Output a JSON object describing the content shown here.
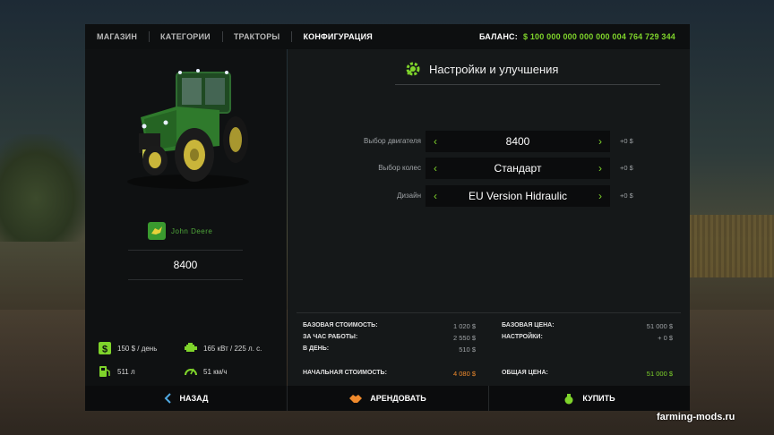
{
  "breadcrumbs": [
    "МАГАЗИН",
    "КАТЕГОРИИ",
    "ТРАКТОРЫ",
    "КОНФИГУРАЦИЯ"
  ],
  "balance": {
    "label": "БАЛАНС:",
    "amount": "$ 100 000 000 000 000 004 764 729 344"
  },
  "vehicle": {
    "brand": "John Deere",
    "model": "8400"
  },
  "stats": {
    "cost_per_day": "150 $ / день",
    "power": "165 кВт / 225 л. с.",
    "fuel": "511 л",
    "speed": "51 км/ч"
  },
  "config": {
    "title": "Настройки и улучшения",
    "options": [
      {
        "label": "Выбор двигателя",
        "value": "8400",
        "price": "+0 $"
      },
      {
        "label": "Выбор колес",
        "value": "Стандарт",
        "price": "+0 $"
      },
      {
        "label": "Дизайн",
        "value": "EU Version Hidraulic",
        "price": "+0 $"
      }
    ]
  },
  "costs": {
    "base_cost_label": "БАЗОВАЯ СТОИМОСТЬ:",
    "base_cost": "1 020 $",
    "per_hour_label": "ЗА ЧАС РАБОТЫ:",
    "per_hour": "2 550 $",
    "per_day_label": "В ДЕНЬ:",
    "per_day": "510 $",
    "initial_label": "НАЧАЛЬНАЯ СТОИМОСТЬ:",
    "initial": "4 080 $",
    "base_price_label": "БАЗОВАЯ ЦЕНА:",
    "base_price": "51 000 $",
    "settings_label": "НАСТРОЙКИ:",
    "settings": "+ 0 $",
    "total_label": "ОБЩАЯ ЦЕНА:",
    "total": "51 000 $"
  },
  "buttons": {
    "back": "НАЗАД",
    "lease": "АРЕНДОВАТЬ",
    "buy": "КУПИТЬ"
  },
  "watermark": "farming-mods.ru",
  "colors": {
    "accent": "#7fd42b",
    "initial_cost": "#f08a2c",
    "panel": "#151819"
  }
}
